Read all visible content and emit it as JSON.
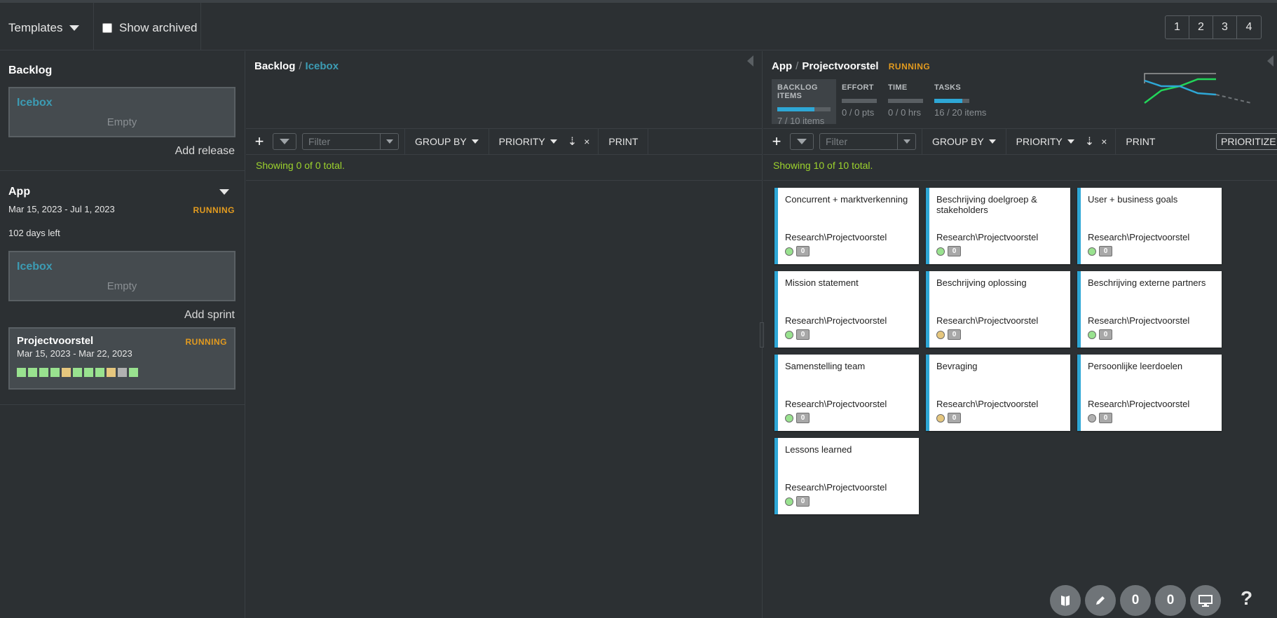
{
  "topbar": {
    "templates_label": "Templates",
    "show_archived_label": "Show archived",
    "pages": [
      "1",
      "2",
      "3",
      "4"
    ]
  },
  "left": {
    "backlog_title": "Backlog",
    "backlog_box": {
      "title": "Icebox",
      "empty": "Empty"
    },
    "add_release": "Add release",
    "release": {
      "name": "App",
      "dates": "Mar 15, 2023  - Jul 1, 2023",
      "status": "RUNNING",
      "days_left": "102 days left",
      "icebox": {
        "title": "Icebox",
        "empty": "Empty"
      },
      "add_sprint": "Add sprint"
    },
    "sprint": {
      "name": "Projectvoorstel",
      "status": "RUNNING",
      "dates": "Mar 15, 2023  - Mar 22, 2023",
      "squares": [
        "#99e28f",
        "#99e28f",
        "#99e28f",
        "#99e28f",
        "#e6c77e",
        "#99e28f",
        "#99e28f",
        "#99e28f",
        "#e6c77e",
        "#b1b1b1",
        "#99e28f"
      ]
    }
  },
  "middle": {
    "crumb_a": "Backlog",
    "crumb_sep": "/",
    "crumb_b": "Icebox",
    "toolbar": {
      "plus": "+",
      "filter_placeholder": "Filter",
      "group_by": "GROUP BY",
      "priority": "PRIORITY",
      "clear": "×",
      "print": "PRINT"
    },
    "showing": "Showing 0 of 0 total."
  },
  "right": {
    "crumb_a": "App",
    "crumb_sep": "/",
    "crumb_b": "Projectvoorstel",
    "status": "RUNNING",
    "stats": [
      {
        "label": "BACKLOG ITEMS",
        "value": "7 / 10  items",
        "progress": 0.7
      },
      {
        "label": "EFFORT",
        "value": "0 / 0 pts",
        "progress": 0
      },
      {
        "label": "TIME",
        "value": "0 / 0 hrs",
        "progress": 0
      },
      {
        "label": "TASKS",
        "value": "16 / 20  items",
        "progress": 0.8
      }
    ],
    "toolbar": {
      "plus": "+",
      "filter_placeholder": "Filter",
      "group_by": "GROUP BY",
      "priority": "PRIORITY",
      "clear": "×",
      "print": "PRINT",
      "prioritize": "PRIORITIZE"
    },
    "showing": "Showing 10 of 10 total.",
    "cards": [
      {
        "title": "Concurrent + marktverkenning",
        "path": "Research\\Projectvoorstel",
        "status_color": "#99e28f",
        "count": "0"
      },
      {
        "title": "Beschrijving doelgroep & stakeholders",
        "path": "Research\\Projectvoorstel",
        "status_color": "#99e28f",
        "count": "0"
      },
      {
        "title": "User + business goals",
        "path": "Research\\Projectvoorstel",
        "status_color": "#99e28f",
        "count": "0"
      },
      {
        "title": "Mission statement",
        "path": "Research\\Projectvoorstel",
        "status_color": "#99e28f",
        "count": "0"
      },
      {
        "title": "Beschrijving oplossing",
        "path": "Research\\Projectvoorstel",
        "status_color": "#e6c77e",
        "count": "0"
      },
      {
        "title": "Beschrijving externe partners",
        "path": "Research\\Projectvoorstel",
        "status_color": "#99e28f",
        "count": "0"
      },
      {
        "title": "Samenstelling team",
        "path": "Research\\Projectvoorstel",
        "status_color": "#99e28f",
        "count": "0"
      },
      {
        "title": "Bevraging",
        "path": "Research\\Projectvoorstel",
        "status_color": "#e6c77e",
        "count": "0"
      },
      {
        "title": "Persoonlijke leerdoelen",
        "path": "Research\\Projectvoorstel",
        "status_color": "#b1b1b1",
        "count": "0"
      },
      {
        "title": "Lessons learned",
        "path": "Research\\Projectvoorstel",
        "status_color": "#99e28f",
        "count": "0"
      }
    ]
  },
  "bottom": {
    "count_a": "0",
    "count_b": "0",
    "help": "?"
  }
}
